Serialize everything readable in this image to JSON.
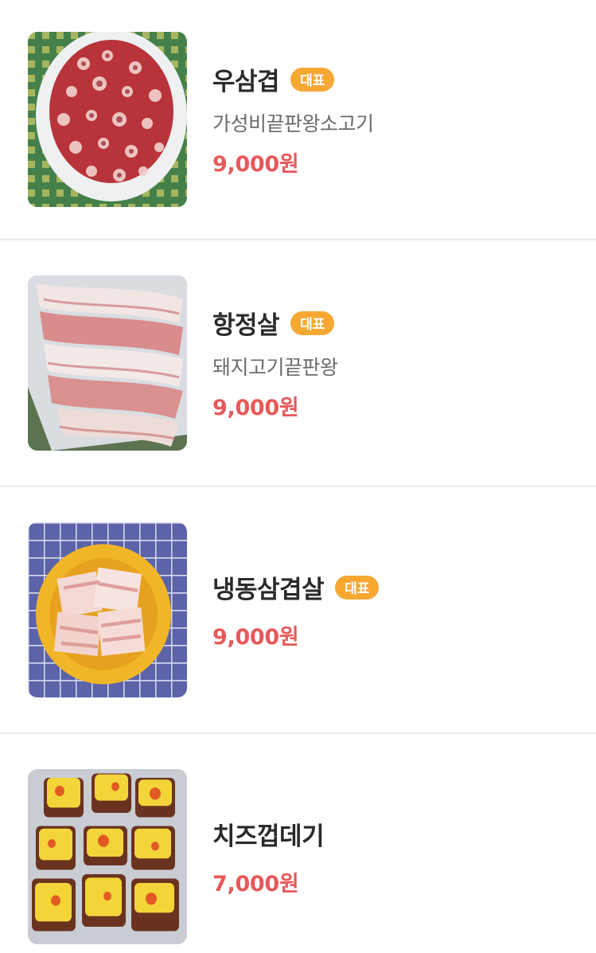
{
  "menu": {
    "items": [
      {
        "name": "우삼겹",
        "badge": "대표",
        "description": "가성비끝판왕소고기",
        "price": "9,000원",
        "image": "beef-brisket-rolls-photo"
      },
      {
        "name": "항정살",
        "badge": "대표",
        "description": "돼지고기끝판왕",
        "price": "9,000원",
        "image": "pork-jowl-slices-photo"
      },
      {
        "name": "냉동삼겹살",
        "badge": "대표",
        "price": "9,000원",
        "image": "frozen-pork-belly-photo"
      },
      {
        "name": "치즈껍데기",
        "price": "7,000원",
        "image": "cheese-pork-skin-photo"
      }
    ]
  },
  "colors": {
    "badge": "#f6a833",
    "price": "#e8595a",
    "divider": "#ececec"
  }
}
